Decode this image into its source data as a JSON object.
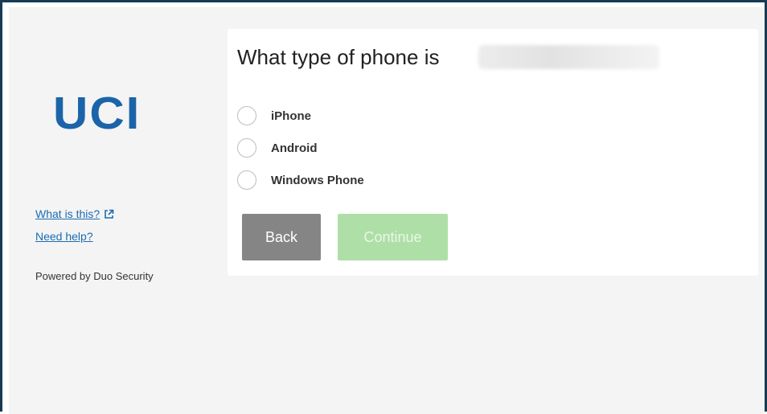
{
  "brand": {
    "logo_text": "UCI",
    "logo_color": "#1c64a9"
  },
  "sidebar": {
    "links": [
      {
        "label": "What is this?",
        "icon": "external-link-icon"
      },
      {
        "label": "Need help?"
      }
    ],
    "powered_by": "Powered by Duo Security"
  },
  "prompt": {
    "title": "What type of phone is",
    "options": [
      {
        "label": "iPhone",
        "selected": false
      },
      {
        "label": "Android",
        "selected": false
      },
      {
        "label": "Windows Phone",
        "selected": false
      }
    ]
  },
  "buttons": {
    "back_label": "Back",
    "continue_label": "Continue",
    "continue_enabled": false
  },
  "colors": {
    "frame_border": "#173a55",
    "link": "#1a6cb3",
    "back_button": "#858585",
    "continue_button_disabled": "#aedfa7"
  }
}
